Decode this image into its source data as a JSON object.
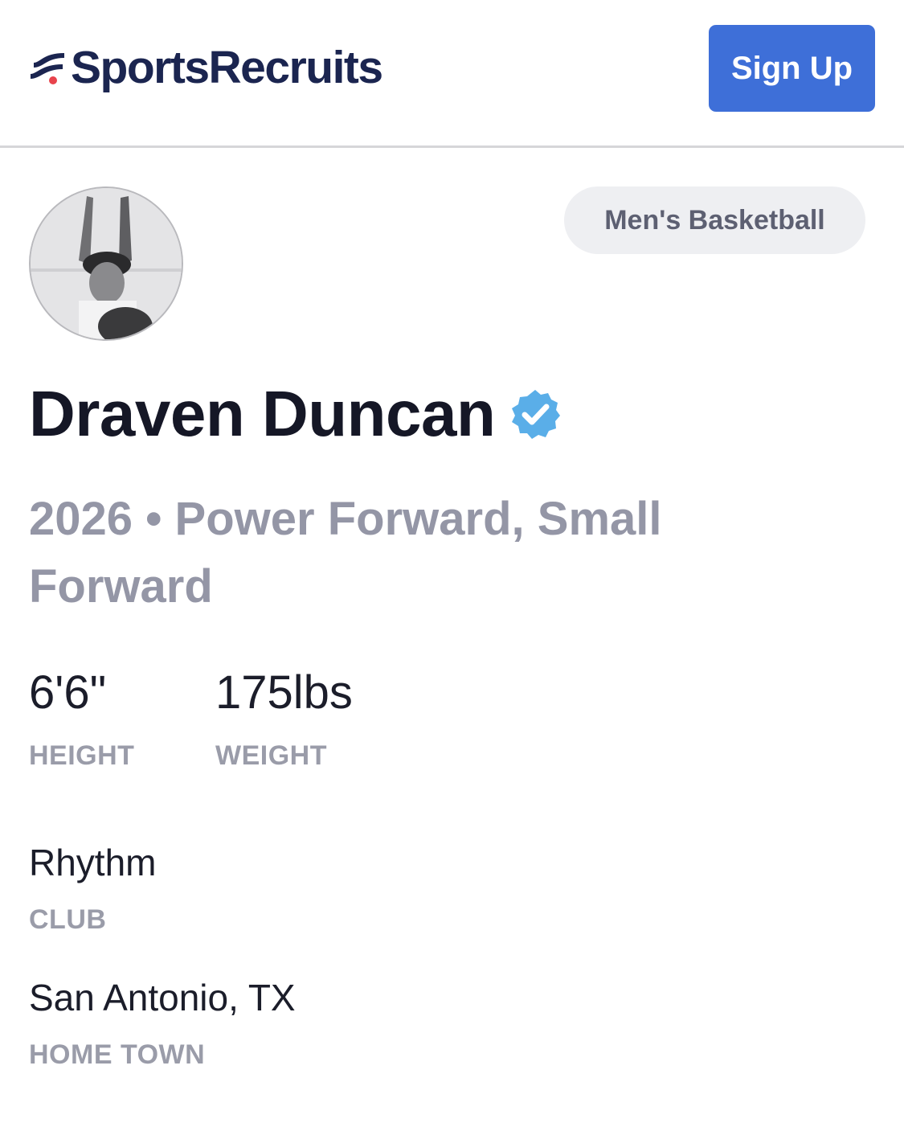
{
  "header": {
    "brand": "SportsRecruits",
    "signup_label": "Sign Up"
  },
  "profile": {
    "avatar": "player-photo",
    "sport": "Men's Basketball",
    "name": "Draven Duncan",
    "verified_icon": "verified-badge-icon",
    "positions": "2026 • Power Forward, Small Forward",
    "stats": [
      {
        "value": "6'6\"",
        "label": "HEIGHT"
      },
      {
        "value": "175lbs",
        "label": "WEIGHT"
      }
    ],
    "info": [
      {
        "value": "Rhythm",
        "label": "CLUB"
      },
      {
        "value": "San Antonio, TX",
        "label": "HOME TOWN"
      }
    ]
  },
  "colors": {
    "brand": "#1b2550",
    "accent": "#3e6fd8",
    "verified": "#5aaee8",
    "logo_dot": "#e8434c"
  }
}
